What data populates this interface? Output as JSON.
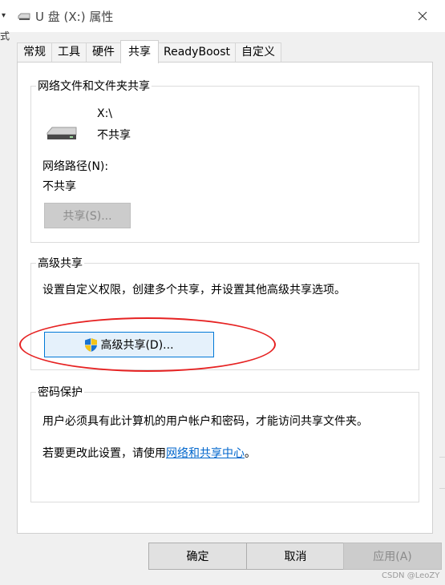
{
  "window": {
    "title": "U 盘 (X:) 属性",
    "edge_glyph_top": "▾",
    "edge_glyph_left": "式"
  },
  "tabs": [
    {
      "label": "常规"
    },
    {
      "label": "工具"
    },
    {
      "label": "硬件"
    },
    {
      "label": "共享",
      "active": true
    },
    {
      "label": "ReadyBoost"
    },
    {
      "label": "自定义"
    }
  ],
  "network_sharing": {
    "legend": "网络文件和文件夹共享",
    "drive_label": "X:\\",
    "drive_status": "不共享",
    "path_label": "网络路径(N):",
    "path_value": "不共享",
    "share_button": "共享(S)..."
  },
  "advanced_sharing": {
    "legend": "高级共享",
    "description": "设置自定义权限，创建多个共享，并设置其他高级共享选项。",
    "button": "高级共享(D)..."
  },
  "password_protection": {
    "legend": "密码保护",
    "description": "用户必须具有此计算机的用户帐户和密码，才能访问共享文件夹。",
    "change_prefix": "若要更改此设置，请使用",
    "change_link": "网络和共享中心",
    "change_suffix": "。"
  },
  "footer": {
    "ok": "确定",
    "cancel": "取消",
    "apply": "应用(A)"
  },
  "watermark": "CSDN @LeoZY",
  "colors": {
    "accent": "#0078d7",
    "link": "#0066cc",
    "annotation": "#e62222"
  },
  "icons": [
    "drive-icon",
    "close-icon",
    "shield-icon"
  ]
}
